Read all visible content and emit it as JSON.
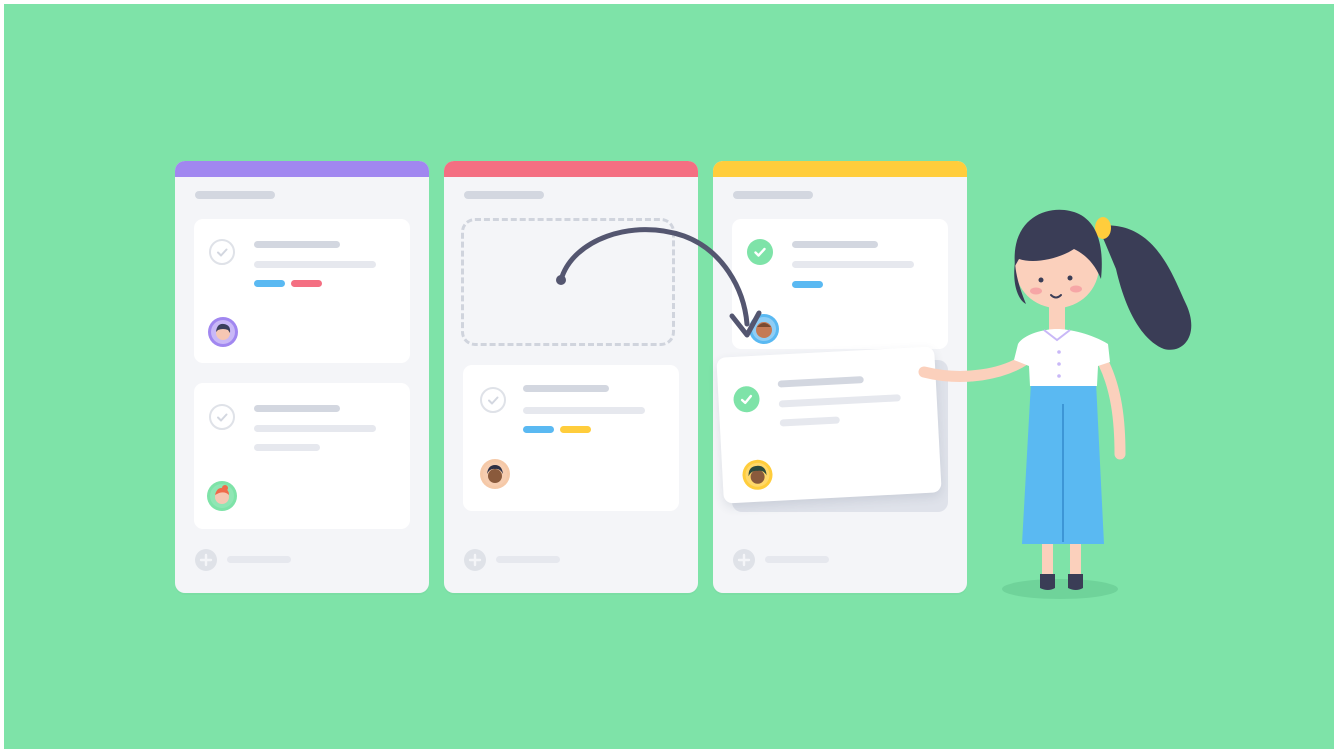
{
  "colors": {
    "background": "#7ee3a8",
    "column_bg": "#f4f5f8",
    "col1_accent": "#a187f0",
    "col2_accent": "#f46f82",
    "col3_accent": "#ffcd3c",
    "tag_blue": "#5ab9f2",
    "tag_red": "#f46f82",
    "tag_yellow": "#ffcd3c",
    "check_done": "#7ee3a8",
    "arrow": "#545670"
  },
  "board": {
    "columns": [
      {
        "name": "column-todo",
        "accent": "col1_accent",
        "cards": 2
      },
      {
        "name": "column-doing",
        "accent": "col2_accent",
        "cards": 1,
        "drop_placeholder": true
      },
      {
        "name": "column-done",
        "accent": "col3_accent",
        "cards": 1,
        "dragged_card": true
      }
    ]
  },
  "icons": [
    "check-icon",
    "add-icon",
    "drag-arrow-icon",
    "avatar-icon"
  ]
}
